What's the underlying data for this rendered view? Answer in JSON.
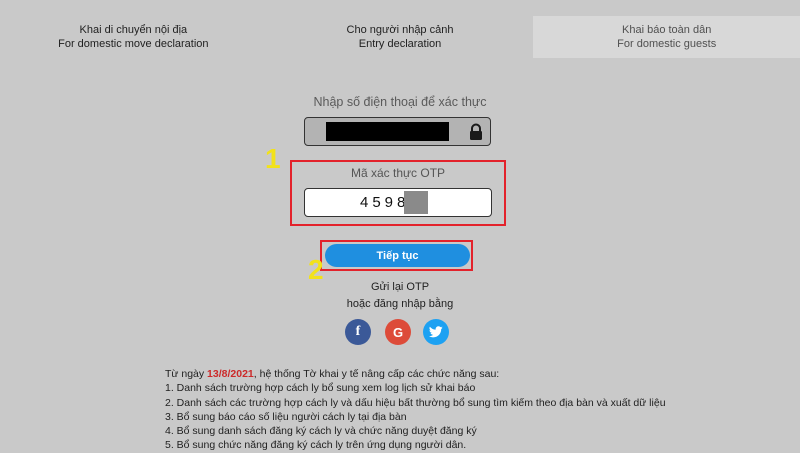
{
  "tabs": [
    {
      "line1": "Khai di chuyển nội địa",
      "line2": "For domestic move declaration",
      "active": false
    },
    {
      "line1": "Cho người nhập cảnh",
      "line2": "Entry declaration",
      "active": false
    },
    {
      "line1": "Khai báo toàn dân",
      "line2": "For domestic guests",
      "active": true
    }
  ],
  "phone": {
    "label": "Nhập số điện thoại để xác thực",
    "value_redacted": true,
    "icon": "lock-icon"
  },
  "otp": {
    "label": "Mã xác thực OTP",
    "value": "4598"
  },
  "annotations": {
    "step1": "1",
    "step2": "2",
    "color": "#f2e21a",
    "frame_color": "#e3222b"
  },
  "continue_button": {
    "label": "Tiếp tục",
    "color": "#1f8fe0"
  },
  "resend_otp": "Gửi lại OTP",
  "or_login_with": "hoặc đăng nhập bằng",
  "social": [
    {
      "name": "facebook-icon",
      "glyph": "f",
      "color": "#3b5998"
    },
    {
      "name": "google-icon",
      "glyph": "G",
      "color": "#dd4b39"
    },
    {
      "name": "twitter-icon",
      "color": "#1da1f2"
    }
  ],
  "notice": {
    "intro_prefix": "Từ ngày ",
    "date": "13/8/2021",
    "intro_suffix": ", hệ thống Tờ khai y tế nâng cấp các chức năng sau:",
    "items": [
      "1. Danh sách trường hợp cách ly bổ sung xem log lịch sử khai báo",
      "2. Danh sách các trường hợp cách ly và dấu hiệu bất thường bổ sung tìm kiếm theo địa bàn và xuất dữ liệu",
      "3. Bổ sung báo cáo số liệu người cách ly tại địa bàn",
      "4. Bổ sung danh sách đăng ký cách ly và chức năng duyệt đăng ký",
      "5. Bổ sung chức năng đăng ký cách ly trên ứng dụng người dân."
    ]
  }
}
